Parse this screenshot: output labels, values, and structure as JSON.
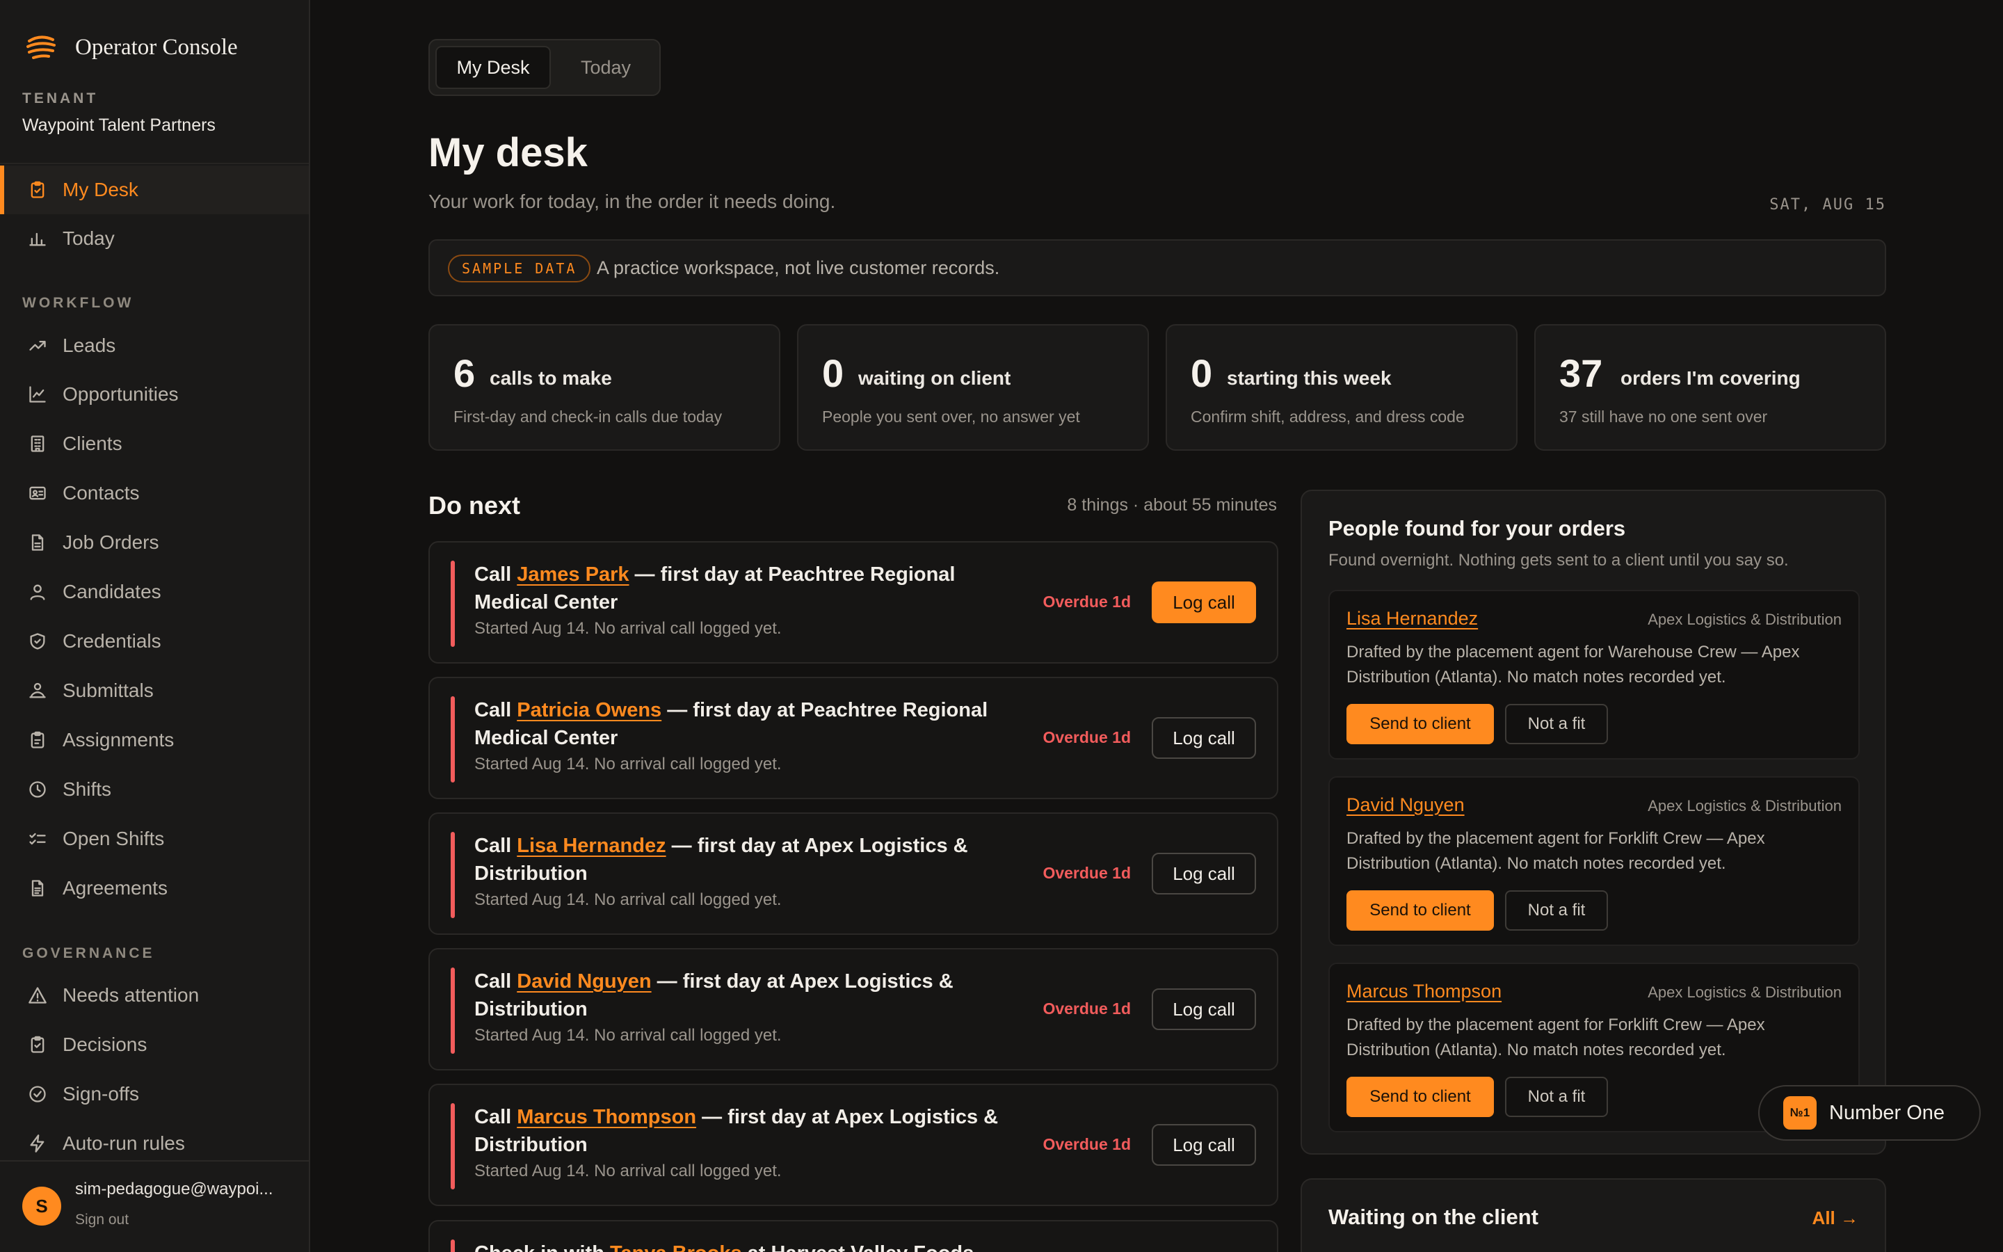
{
  "app": {
    "name": "Operator Console"
  },
  "tenant": {
    "caption": "TENANT",
    "name": "Waypoint Talent Partners"
  },
  "nav": {
    "top": [
      {
        "label": "My Desk",
        "icon": "clipboard-icon"
      },
      {
        "label": "Today",
        "icon": "bar-chart-icon"
      }
    ],
    "workflow_caption": "WORKFLOW",
    "workflow": [
      {
        "label": "Leads",
        "icon": "trend-up-icon"
      },
      {
        "label": "Opportunities",
        "icon": "line-chart-icon"
      },
      {
        "label": "Clients",
        "icon": "building-icon"
      },
      {
        "label": "Contacts",
        "icon": "id-card-icon"
      },
      {
        "label": "Job Orders",
        "icon": "document-icon"
      },
      {
        "label": "Candidates",
        "icon": "user-icon"
      },
      {
        "label": "Credentials",
        "icon": "shield-icon"
      },
      {
        "label": "Submittals",
        "icon": "user-handoff-icon"
      },
      {
        "label": "Assignments",
        "icon": "clipboard-check-icon"
      },
      {
        "label": "Shifts",
        "icon": "clock-icon"
      },
      {
        "label": "Open Shifts",
        "icon": "checklist-icon"
      },
      {
        "label": "Agreements",
        "icon": "file-text-icon"
      }
    ],
    "governance_caption": "GOVERNANCE",
    "governance": [
      {
        "label": "Needs attention",
        "icon": "warning-icon"
      },
      {
        "label": "Decisions",
        "icon": "clipboard-icon"
      },
      {
        "label": "Sign-offs",
        "icon": "check-circle-icon"
      },
      {
        "label": "Auto-run rules",
        "icon": "bolt-icon"
      }
    ]
  },
  "user": {
    "initial": "S",
    "email": "sim-pedagogue@waypoi...",
    "sign_out": "Sign out"
  },
  "tabs": [
    "My Desk",
    "Today"
  ],
  "page": {
    "title": "My desk",
    "subtitle": "Your work for today, in the order it needs doing.",
    "date": "SAT, AUG 15"
  },
  "banner": {
    "badge": "SAMPLE DATA",
    "text": "A practice workspace, not live customer records."
  },
  "stats": [
    {
      "num": "6",
      "label": "calls to make",
      "sub": "First-day and check-in calls due today"
    },
    {
      "num": "0",
      "label": "waiting on client",
      "sub": "People you sent over, no answer yet"
    },
    {
      "num": "0",
      "label": "starting this week",
      "sub": "Confirm shift, address, and dress code"
    },
    {
      "num": "37",
      "label": "orders I'm covering",
      "sub": "37 still have no one sent over"
    }
  ],
  "do_next": {
    "title": "Do next",
    "meta": "8 things · about 55 minutes",
    "tasks": [
      {
        "prefix": "Call ",
        "person": "James Park",
        "suffix": " — first day at Peachtree Regional Medical Center",
        "sub": "Started Aug 14. No arrival call logged yet.",
        "status": "Overdue 1d",
        "action": "Log call"
      },
      {
        "prefix": "Call ",
        "person": "Patricia Owens",
        "suffix": " — first day at Peachtree Regional Medical Center",
        "sub": "Started Aug 14. No arrival call logged yet.",
        "status": "Overdue 1d",
        "action": "Log call"
      },
      {
        "prefix": "Call ",
        "person": "Lisa Hernandez",
        "suffix": " — first day at Apex Logistics & Distribution",
        "sub": "Started Aug 14. No arrival call logged yet.",
        "status": "Overdue 1d",
        "action": "Log call"
      },
      {
        "prefix": "Call ",
        "person": "David Nguyen",
        "suffix": " — first day at Apex Logistics & Distribution",
        "sub": "Started Aug 14. No arrival call logged yet.",
        "status": "Overdue 1d",
        "action": "Log call"
      },
      {
        "prefix": "Call ",
        "person": "Marcus Thompson",
        "suffix": " — first day at Apex Logistics & Distribution",
        "sub": "Started Aug 14. No arrival call logged yet.",
        "status": "Overdue 1d",
        "action": "Log call"
      },
      {
        "prefix": "Check in with ",
        "person": "Tanya Brooks",
        "suffix": " at Harvest Valley Foods",
        "sub": "",
        "status": "",
        "action": ""
      }
    ]
  },
  "found": {
    "title": "People found for your orders",
    "subtitle": "Found overnight. Nothing gets sent to a client until you say so.",
    "candidates": [
      {
        "name": "Lisa Hernandez",
        "company": "Apex Logistics & Distribution",
        "desc": "Drafted by the placement agent for Warehouse Crew — Apex Distribution (Atlanta). No match notes recorded yet.",
        "send": "Send to client",
        "reject": "Not a fit"
      },
      {
        "name": "David Nguyen",
        "company": "Apex Logistics & Distribution",
        "desc": "Drafted by the placement agent for Forklift Crew — Apex Distribution (Atlanta). No match notes recorded yet.",
        "send": "Send to client",
        "reject": "Not a fit"
      },
      {
        "name": "Marcus Thompson",
        "company": "Apex Logistics & Distribution",
        "desc": "Drafted by the placement agent for Forklift Crew — Apex Distribution (Atlanta). No match notes recorded yet.",
        "send": "Send to client",
        "reject": "Not a fit"
      }
    ]
  },
  "waiting": {
    "title": "Waiting on the client",
    "link": "All →"
  },
  "assistant": {
    "badge": "№1",
    "label": "Number One"
  },
  "colors": {
    "accent": "#ff8a1f",
    "danger": "#f25c5c",
    "background": "#121110",
    "panel": "#1a1918"
  }
}
